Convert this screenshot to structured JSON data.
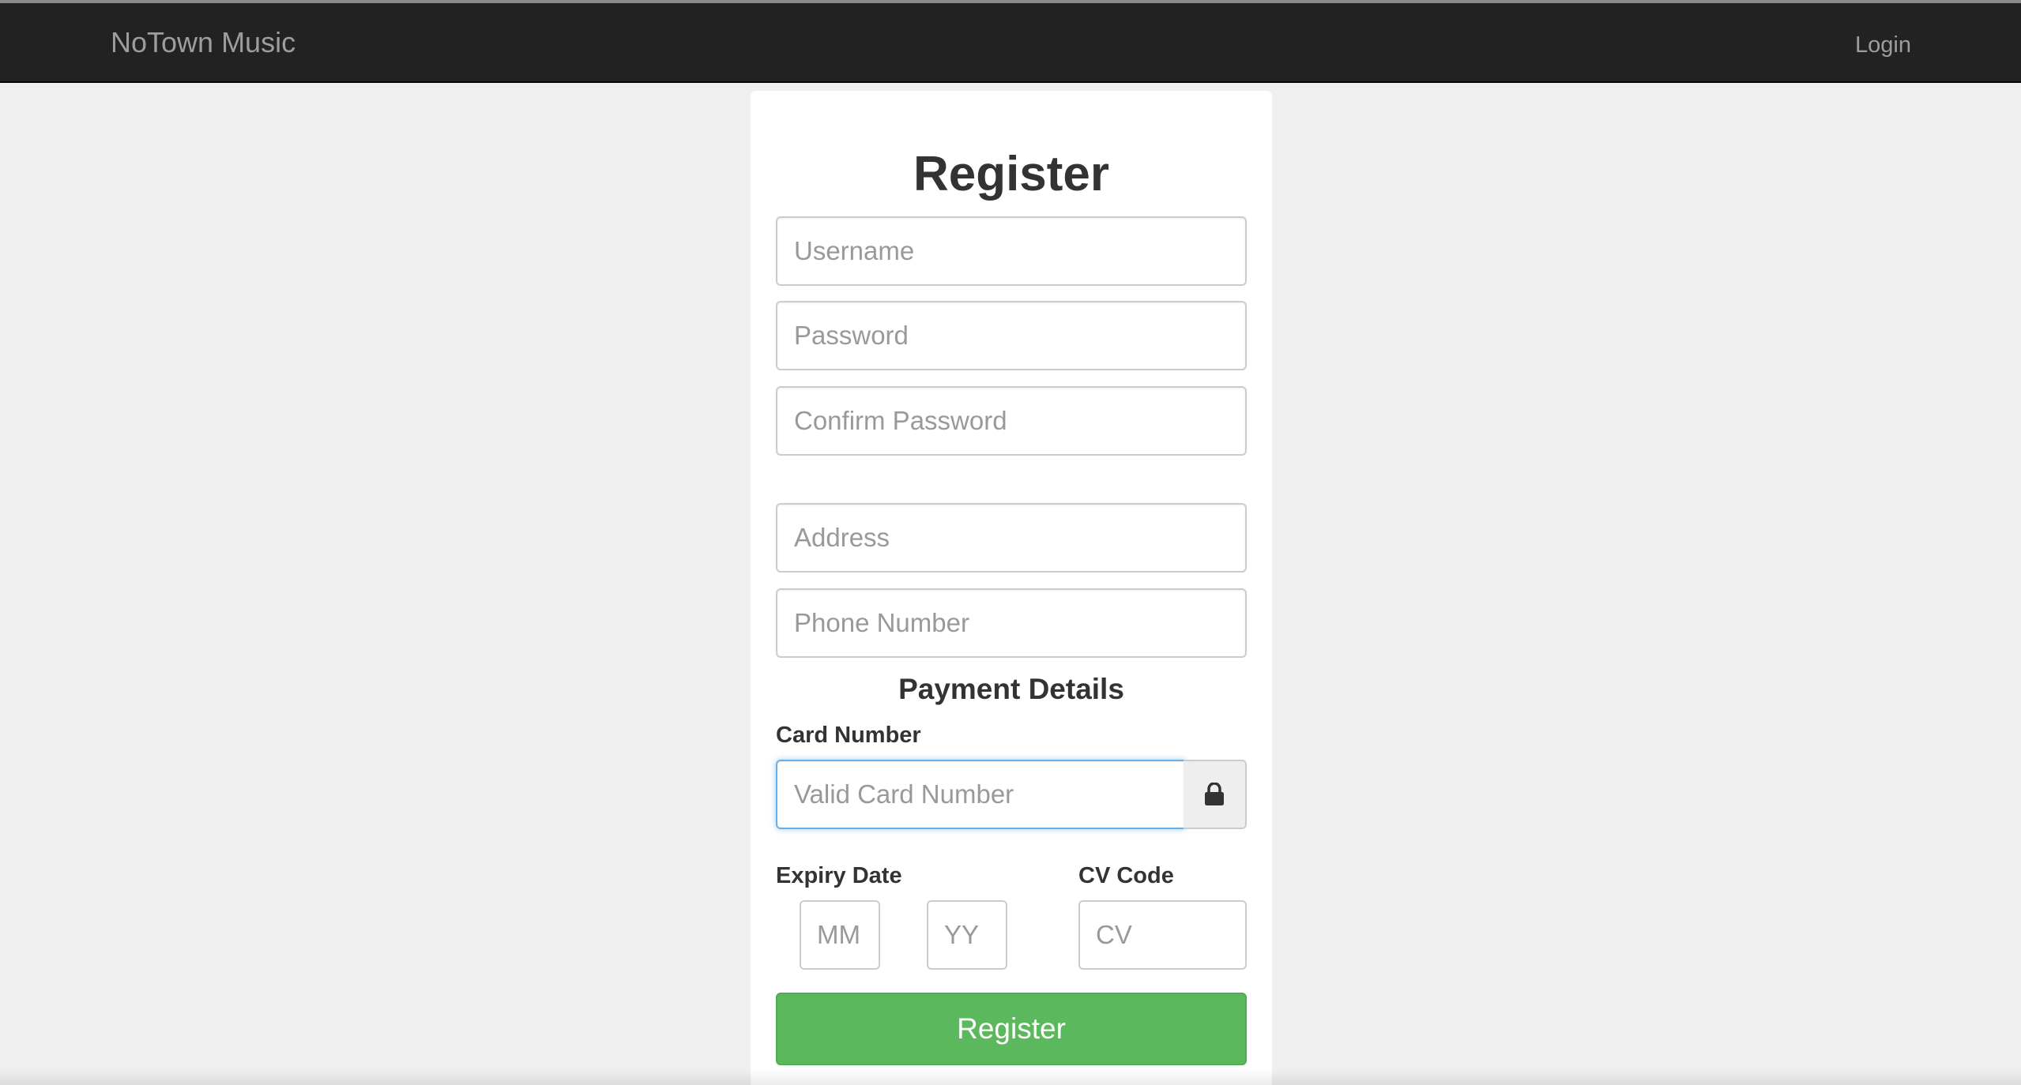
{
  "navbar": {
    "brand": "NoTown Music",
    "login_link": "Login"
  },
  "form": {
    "title": "Register",
    "username_placeholder": "Username",
    "password_placeholder": "Password",
    "confirm_password_placeholder": "Confirm Password",
    "address_placeholder": "Address",
    "phone_placeholder": "Phone Number",
    "payment_title": "Payment Details",
    "card_number_label": "Card Number",
    "card_number_placeholder": "Valid Card Number",
    "card_addon_icon": "lock-icon",
    "expiry_label": "Expiry Date",
    "expiry_month_placeholder": "MM",
    "expiry_year_placeholder": "YY",
    "cv_label": "CV Code",
    "cv_placeholder": "CV",
    "register_button": "Register"
  },
  "colors": {
    "navbar_bg": "#222222",
    "page_bg": "#efefef",
    "button_success": "#5cb85c",
    "focus_border": "#66afe9"
  }
}
